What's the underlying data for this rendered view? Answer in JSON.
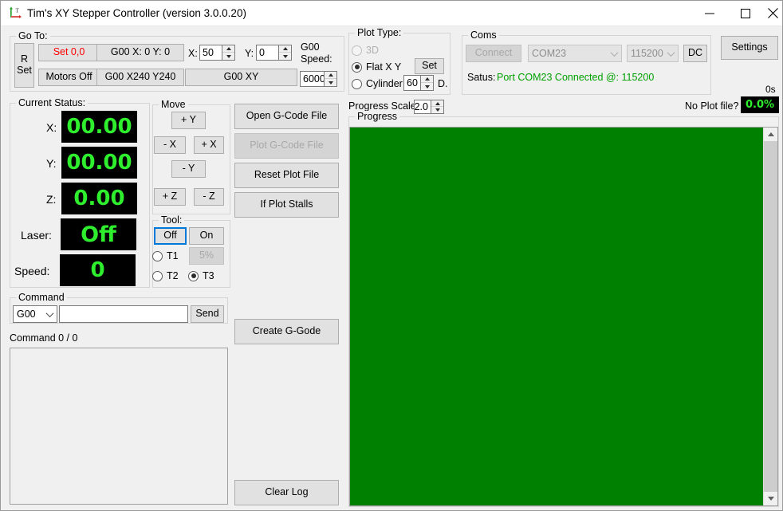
{
  "window": {
    "title": "Tim's XY Stepper Controller (version 3.0.0.20)",
    "icon": "axes-icon",
    "minimize": "minimize-icon",
    "maximize": "maximize-icon",
    "close": "close-icon"
  },
  "goto": {
    "legend": "Go To:",
    "rset_line1": "R",
    "rset_line2": "Set",
    "set00": "Set 0,0",
    "motors_off": "Motors Off",
    "g00_xy_zero": "G00 X: 0 Y: 0",
    "g00_x240y240": "G00 X240 Y240",
    "g00_xy": "G00  XY",
    "x_label": "X:",
    "x_value": "50",
    "y_label": "Y:",
    "y_value": "0",
    "speed_label_line1": "G00",
    "speed_label_line2": "Speed:",
    "speed_value": "6000"
  },
  "plot_type": {
    "legend": "Plot Type:",
    "opt_3d": "3D",
    "opt_flat": "Flat X Y",
    "opt_cyl": "Cylinder",
    "selected": "Flat X Y",
    "set_button": "Set",
    "cyl_value": "60",
    "cyl_unit": "D."
  },
  "coms": {
    "legend": "Coms",
    "connect": "Connect",
    "port": "COM23",
    "baud": "115200",
    "dc": "DC",
    "status_label": "Satus:",
    "status_value": "Port COM23 Connected @: 115200",
    "status_color": "#00a000"
  },
  "settings_button": "Settings",
  "elapsed": "0s",
  "progress_scale": {
    "label": "Progress Scale:",
    "value": "2.0"
  },
  "no_plot_file": "No Plot file?",
  "percent": "0.0%",
  "progress": {
    "legend": "Progress",
    "plot_color": "#008000"
  },
  "current_status": {
    "legend": "Current Status:",
    "rows": [
      {
        "label": "X:",
        "value": "00.00"
      },
      {
        "label": "Y:",
        "value": "00.00"
      },
      {
        "label": "Z:",
        "value": "0.00"
      },
      {
        "label": "Laser:",
        "value": "Off"
      },
      {
        "label": "Speed:",
        "value": "0"
      }
    ],
    "lcd_color": "#2eee2e",
    "lcd_bg": "#000000"
  },
  "move": {
    "legend": "Move",
    "plus_y": "+ Y",
    "minus_x": "- X",
    "plus_x": "+ X",
    "minus_y": "- Y",
    "plus_z": "+ Z",
    "minus_z": "- Z"
  },
  "tool": {
    "legend": "Tool:",
    "off": "Off",
    "on": "On",
    "t1": "T1",
    "percent5": "5%",
    "t2": "T2",
    "t3": "T3",
    "selected": "T3"
  },
  "actions": {
    "open_gcode": "Open G-Code File",
    "plot_gcode": "Plot G-Code File",
    "reset_plot": "Reset Plot File",
    "if_stalls": "If Plot Stalls",
    "create_gcode": "Create G-Gode",
    "clear_log": "Clear Log"
  },
  "command": {
    "legend": "Command",
    "dropdown": "G00",
    "input_value": "",
    "input_placeholder": "",
    "send": "Send",
    "counter": "Command 0 / 0",
    "log_value": ""
  }
}
